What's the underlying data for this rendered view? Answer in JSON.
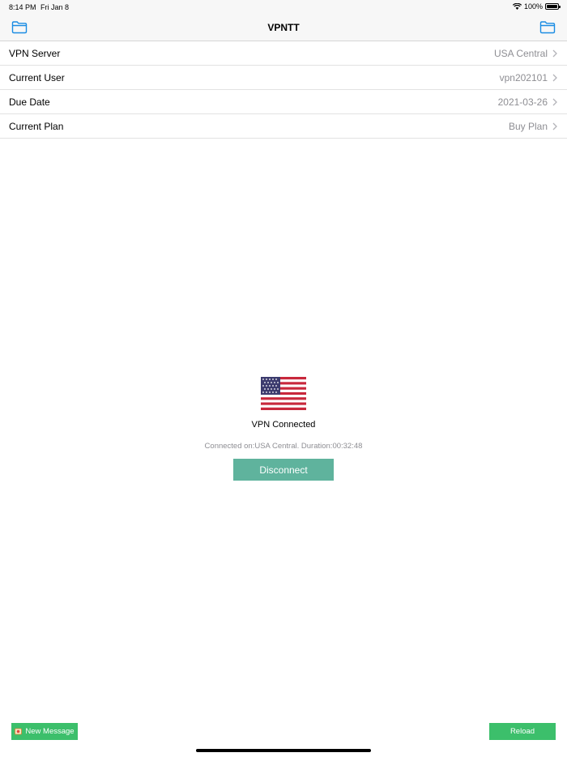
{
  "status_bar": {
    "time": "8:14 PM",
    "date": "Fri Jan 8",
    "battery": "100%"
  },
  "nav": {
    "title": "VPNTT",
    "left_icon": "folder-icon",
    "right_icon": "folder-icon"
  },
  "rows": [
    {
      "label": "VPN Server",
      "value": "USA Central"
    },
    {
      "label": "Current User",
      "value": "vpn202101"
    },
    {
      "label": "Due Date",
      "value": "2021-03-26"
    },
    {
      "label": "Current Plan",
      "value": "Buy Plan"
    }
  ],
  "connection": {
    "flag_icon": "usa-flag-icon",
    "status": "VPN Connected",
    "detail": "Connected on:USA Central. Duration:00:32:48",
    "button": "Disconnect"
  },
  "bottom": {
    "message_label": "New Message",
    "reload_label": "Reload"
  },
  "colors": {
    "accent_blue": "#1a8ce3",
    "disconnect_green": "#5fb39d",
    "button_green": "#3cbf6b"
  }
}
